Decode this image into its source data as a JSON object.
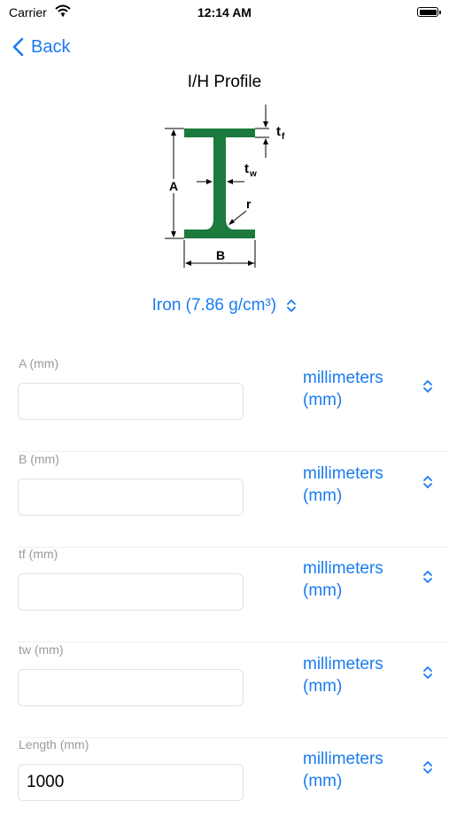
{
  "status": {
    "carrier": "Carrier",
    "time": "12:14 AM"
  },
  "nav": {
    "back_label": "Back"
  },
  "title": "I/H Profile",
  "diagram": {
    "labels": {
      "A": "A",
      "B": "B",
      "tf": "t",
      "tf_sub": "f",
      "tw": "t",
      "tw_sub": "w",
      "r": "r"
    },
    "profile_color": "#1b7a3c"
  },
  "material": {
    "label": "Iron (7.86 g/cm³)"
  },
  "fields": [
    {
      "label": "A (mm)",
      "value": "",
      "unit": "millimeters (mm)"
    },
    {
      "label": "B (mm)",
      "value": "",
      "unit": "millimeters (mm)"
    },
    {
      "label": "tf (mm)",
      "value": "",
      "unit": "millimeters (mm)"
    },
    {
      "label": "tw (mm)",
      "value": "",
      "unit": "millimeters (mm)"
    },
    {
      "label": "Length (mm)",
      "value": "1000",
      "unit": "millimeters (mm)"
    }
  ],
  "colors": {
    "accent": "#1a7cf0",
    "label_gray": "#9a9a9a"
  }
}
